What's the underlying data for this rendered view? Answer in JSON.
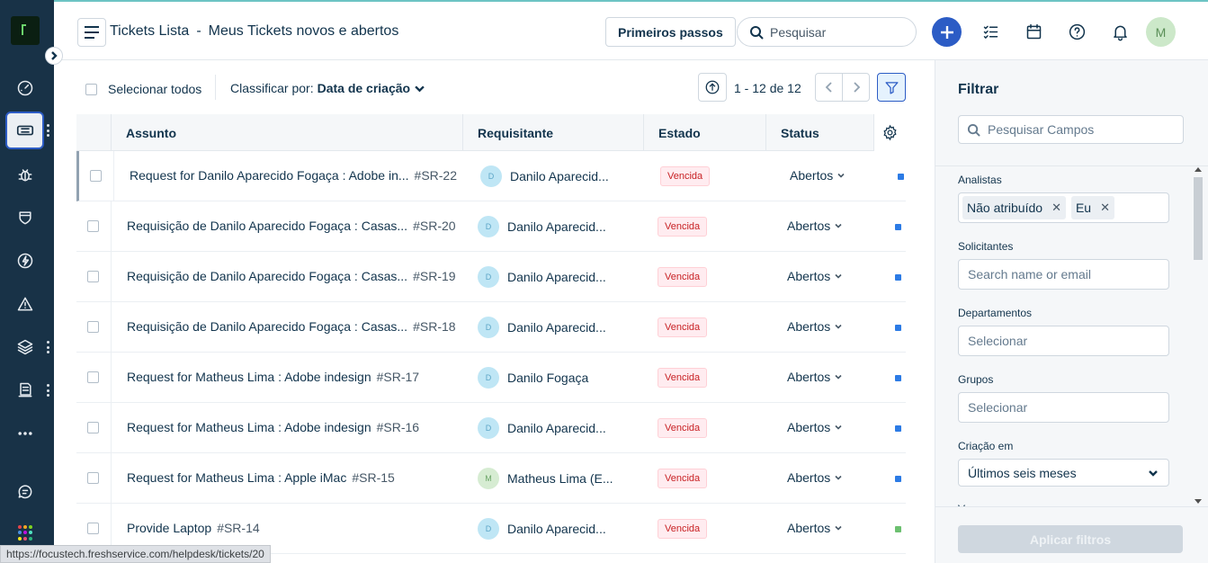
{
  "header": {
    "title": "Tickets Lista",
    "subtitle": "Meus Tickets novos e abertos",
    "title_separator": "-",
    "first_steps_label": "Primeiros passos",
    "search_placeholder": "Pesquisar",
    "avatar_initial": "M"
  },
  "rail": {
    "icons": [
      "dashboard-icon",
      "tickets-icon",
      "bug-icon",
      "shield-icon",
      "lightning-icon",
      "alert-icon",
      "layers-icon",
      "assets-icon",
      "more-icon",
      "chat-icon",
      "apps-grid-icon"
    ],
    "active": "tickets-icon"
  },
  "toolbar": {
    "select_all_label": "Selecionar todos",
    "sort_prefix": "Classificar por:",
    "sort_value": "Data de criação",
    "pager_text": "1 - 12 de 12"
  },
  "table": {
    "columns": [
      "Assunto",
      "Requisitante",
      "Estado",
      "Status"
    ],
    "rows": [
      {
        "subject": "Request for Danilo Aparecido Fogaça : Adobe in...",
        "id": "#SR-22",
        "avatar": "D",
        "avatar_color": "blue",
        "requester": "Danilo Aparecid...",
        "state": "Vencida",
        "status": "Abertos",
        "priority_color": "#2c7be5"
      },
      {
        "subject": "Requisição de Danilo Aparecido Fogaça : Casas...",
        "id": "#SR-20",
        "avatar": "D",
        "avatar_color": "blue",
        "requester": "Danilo Aparecid...",
        "state": "Vencida",
        "status": "Abertos",
        "priority_color": "#2c7be5"
      },
      {
        "subject": "Requisição de Danilo Aparecido Fogaça : Casas...",
        "id": "#SR-19",
        "avatar": "D",
        "avatar_color": "blue",
        "requester": "Danilo Aparecid...",
        "state": "Vencida",
        "status": "Abertos",
        "priority_color": "#2c7be5"
      },
      {
        "subject": "Requisição de Danilo Aparecido Fogaça : Casas...",
        "id": "#SR-18",
        "avatar": "D",
        "avatar_color": "blue",
        "requester": "Danilo Aparecid...",
        "state": "Vencida",
        "status": "Abertos",
        "priority_color": "#2c7be5"
      },
      {
        "subject": "Request for Matheus Lima : Adobe indesign",
        "id": "#SR-17",
        "avatar": "D",
        "avatar_color": "blue",
        "requester": "Danilo Fogaça",
        "state": "Vencida",
        "status": "Abertos",
        "priority_color": "#2c7be5"
      },
      {
        "subject": "Request for Matheus Lima : Adobe indesign",
        "id": "#SR-16",
        "avatar": "D",
        "avatar_color": "blue",
        "requester": "Danilo Aparecid...",
        "state": "Vencida",
        "status": "Abertos",
        "priority_color": "#2c7be5"
      },
      {
        "subject": "Request for Matheus Lima : Apple iMac",
        "id": "#SR-15",
        "avatar": "M",
        "avatar_color": "green",
        "requester": "Matheus Lima (E...",
        "state": "Vencida",
        "status": "Abertos",
        "priority_color": "#2c7be5"
      },
      {
        "subject": "Provide Laptop",
        "id": "#SR-14",
        "avatar": "D",
        "avatar_color": "blue",
        "requester": "Danilo Aparecid...",
        "state": "Vencida",
        "status": "Abertos",
        "priority_color": "#6cc070"
      }
    ]
  },
  "filter": {
    "title": "Filtrar",
    "search_placeholder": "Pesquisar Campos",
    "fields": {
      "analysts_label": "Analistas",
      "analyst_tags": [
        "Não atribuído",
        "Eu"
      ],
      "requesters_label": "Solicitantes",
      "requesters_placeholder": "Search name or email",
      "departments_label": "Departamentos",
      "departments_placeholder": "Selecionar",
      "groups_label": "Grupos",
      "groups_placeholder": "Selecionar",
      "created_label": "Criação em",
      "created_value": "Últimos seis meses",
      "next_label": "V"
    },
    "apply_label": "Aplicar filtros"
  },
  "statusbar": {
    "url": "https://focustech.freshservice.com/helpdesk/tickets/20"
  }
}
